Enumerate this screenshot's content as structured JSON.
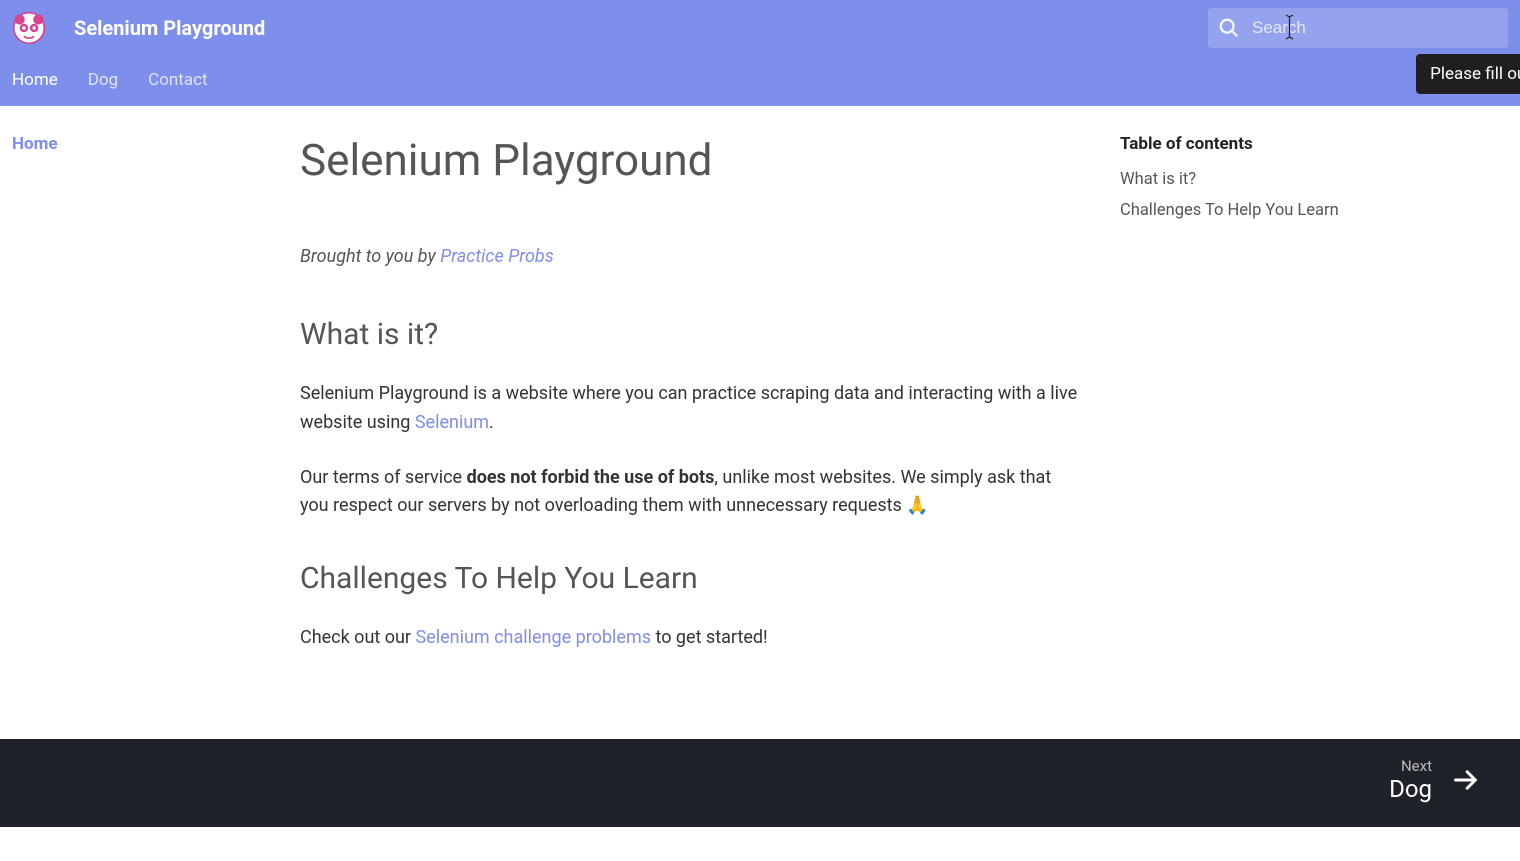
{
  "header": {
    "site_title": "Selenium Playground",
    "search_placeholder": "Search",
    "tooltip": "Please fill out this f"
  },
  "tabs": [
    {
      "label": "Home",
      "active": true
    },
    {
      "label": "Dog",
      "active": false
    },
    {
      "label": "Contact",
      "active": false
    }
  ],
  "sidebar_left": {
    "items": [
      {
        "label": "Home"
      }
    ]
  },
  "main": {
    "page_title": "Selenium Playground",
    "intro_prefix": "Brought to you by ",
    "intro_link": "Practice Probs",
    "section1": {
      "heading": "What is it?",
      "p1_a": "Selenium Playground is a website where you can practice scraping data and interacting with a live website using ",
      "p1_link": "Selenium",
      "p1_b": ".",
      "p2_a": "Our terms of service ",
      "p2_bold": "does not forbid the use of bots",
      "p2_b": ", unlike most websites. We simply ask that you respect our servers by not overloading them with unnecessary requests ",
      "p2_emoji": "🙏"
    },
    "section2": {
      "heading": "Challenges To Help You Learn",
      "p1_a": "Check out our ",
      "p1_link": "Selenium challenge problems",
      "p1_b": " to get started!"
    }
  },
  "toc": {
    "title": "Table of contents",
    "items": [
      {
        "label": "What is it?"
      },
      {
        "label": "Challenges To Help You Learn"
      }
    ]
  },
  "footer": {
    "next_label": "Next",
    "next_dest": "Dog"
  }
}
